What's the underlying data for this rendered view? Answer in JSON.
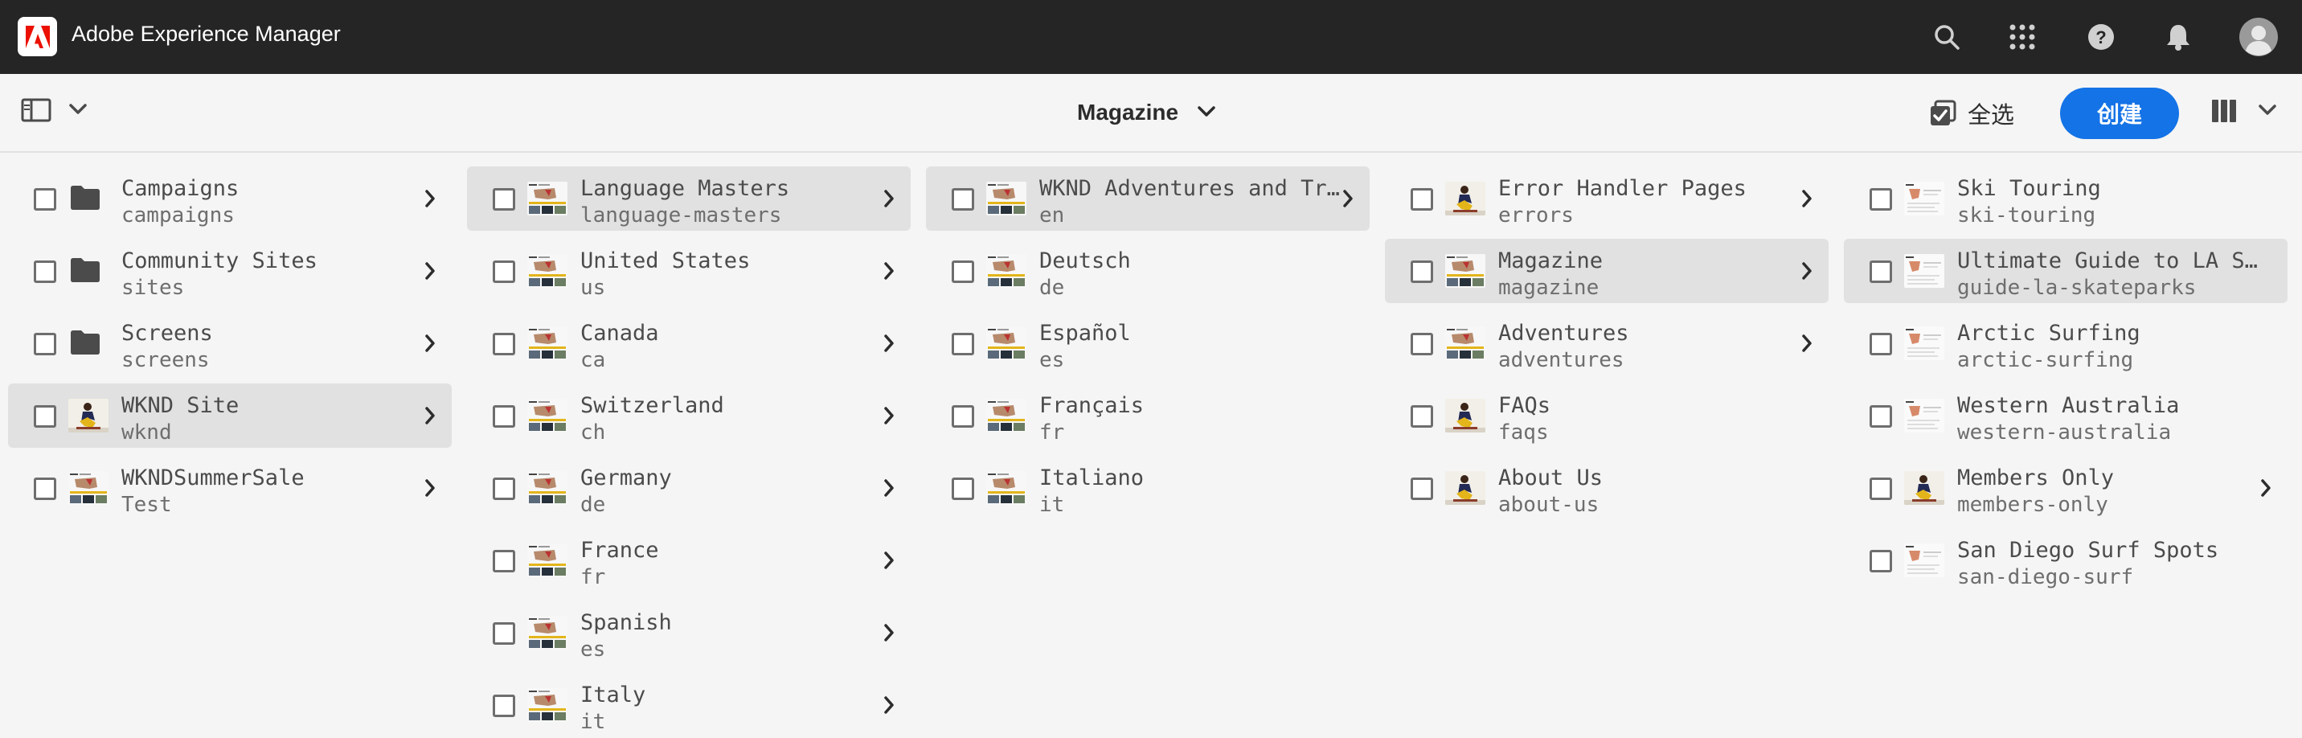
{
  "shell": {
    "title": "Adobe Experience Manager",
    "icons": [
      "search-icon",
      "apps-grid-icon",
      "help-icon",
      "notifications-bell-icon",
      "user-avatar-icon"
    ]
  },
  "actionbar": {
    "title": "Magazine",
    "select_all_label": "全选",
    "create_label": "创建"
  },
  "colors": {
    "shell_bg": "#252525",
    "accent": "#1473e6",
    "selected_row": "#e1e1e1"
  },
  "columns": [
    {
      "items": [
        {
          "title": "Campaigns",
          "name": "campaigns",
          "icon": "folder",
          "chevron": true,
          "selected": false
        },
        {
          "title": "Community Sites",
          "name": "sites",
          "icon": "folder",
          "chevron": true,
          "selected": false
        },
        {
          "title": "Screens",
          "name": "screens",
          "icon": "folder",
          "chevron": true,
          "selected": false
        },
        {
          "title": "WKND Site",
          "name": "wknd",
          "icon": "thumb-skater",
          "chevron": true,
          "selected": true
        },
        {
          "title": "WKNDSummerSale",
          "name": "Test",
          "icon": "thumb-page",
          "chevron": true,
          "selected": false
        }
      ]
    },
    {
      "items": [
        {
          "title": "Language Masters",
          "name": "language-masters",
          "icon": "thumb-page",
          "chevron": true,
          "selected": true
        },
        {
          "title": "United States",
          "name": "us",
          "icon": "thumb-page",
          "chevron": true,
          "selected": false
        },
        {
          "title": "Canada",
          "name": "ca",
          "icon": "thumb-page",
          "chevron": true,
          "selected": false
        },
        {
          "title": "Switzerland",
          "name": "ch",
          "icon": "thumb-page",
          "chevron": true,
          "selected": false
        },
        {
          "title": "Germany",
          "name": "de",
          "icon": "thumb-page",
          "chevron": true,
          "selected": false
        },
        {
          "title": "France",
          "name": "fr",
          "icon": "thumb-page",
          "chevron": true,
          "selected": false
        },
        {
          "title": "Spanish",
          "name": "es",
          "icon": "thumb-page",
          "chevron": true,
          "selected": false
        },
        {
          "title": "Italy",
          "name": "it",
          "icon": "thumb-page",
          "chevron": true,
          "selected": false
        }
      ]
    },
    {
      "items": [
        {
          "title": "WKND Adventures and Travel",
          "name": "en",
          "icon": "thumb-page",
          "chevron": true,
          "selected": true
        },
        {
          "title": "Deutsch",
          "name": "de",
          "icon": "thumb-page",
          "chevron": false,
          "selected": false
        },
        {
          "title": "Español",
          "name": "es",
          "icon": "thumb-page",
          "chevron": false,
          "selected": false
        },
        {
          "title": "Français",
          "name": "fr",
          "icon": "thumb-page",
          "chevron": false,
          "selected": false
        },
        {
          "title": "Italiano",
          "name": "it",
          "icon": "thumb-page",
          "chevron": false,
          "selected": false
        }
      ]
    },
    {
      "items": [
        {
          "title": "Error Handler Pages",
          "name": "errors",
          "icon": "thumb-skater",
          "chevron": true,
          "selected": false
        },
        {
          "title": "Magazine",
          "name": "magazine",
          "icon": "thumb-page",
          "chevron": true,
          "selected": true
        },
        {
          "title": "Adventures",
          "name": "adventures",
          "icon": "thumb-page",
          "chevron": true,
          "selected": false
        },
        {
          "title": "FAQs",
          "name": "faqs",
          "icon": "thumb-skater",
          "chevron": false,
          "selected": false
        },
        {
          "title": "About Us",
          "name": "about-us",
          "icon": "thumb-skater",
          "chevron": false,
          "selected": false
        }
      ]
    },
    {
      "items": [
        {
          "title": "Ski Touring",
          "name": "ski-touring",
          "icon": "thumb-article",
          "chevron": false,
          "selected": false
        },
        {
          "title": "Ultimate Guide to LA Skateparks",
          "name": "guide-la-skateparks",
          "icon": "thumb-article",
          "chevron": false,
          "selected": true
        },
        {
          "title": "Arctic Surfing",
          "name": "arctic-surfing",
          "icon": "thumb-article",
          "chevron": false,
          "selected": false
        },
        {
          "title": "Western Australia",
          "name": "western-australia",
          "icon": "thumb-article",
          "chevron": false,
          "selected": false
        },
        {
          "title": "Members Only",
          "name": "members-only",
          "icon": "thumb-skater",
          "chevron": true,
          "selected": false
        },
        {
          "title": "San Diego Surf Spots",
          "name": "san-diego-surf",
          "icon": "thumb-article",
          "chevron": false,
          "selected": false
        }
      ]
    }
  ]
}
